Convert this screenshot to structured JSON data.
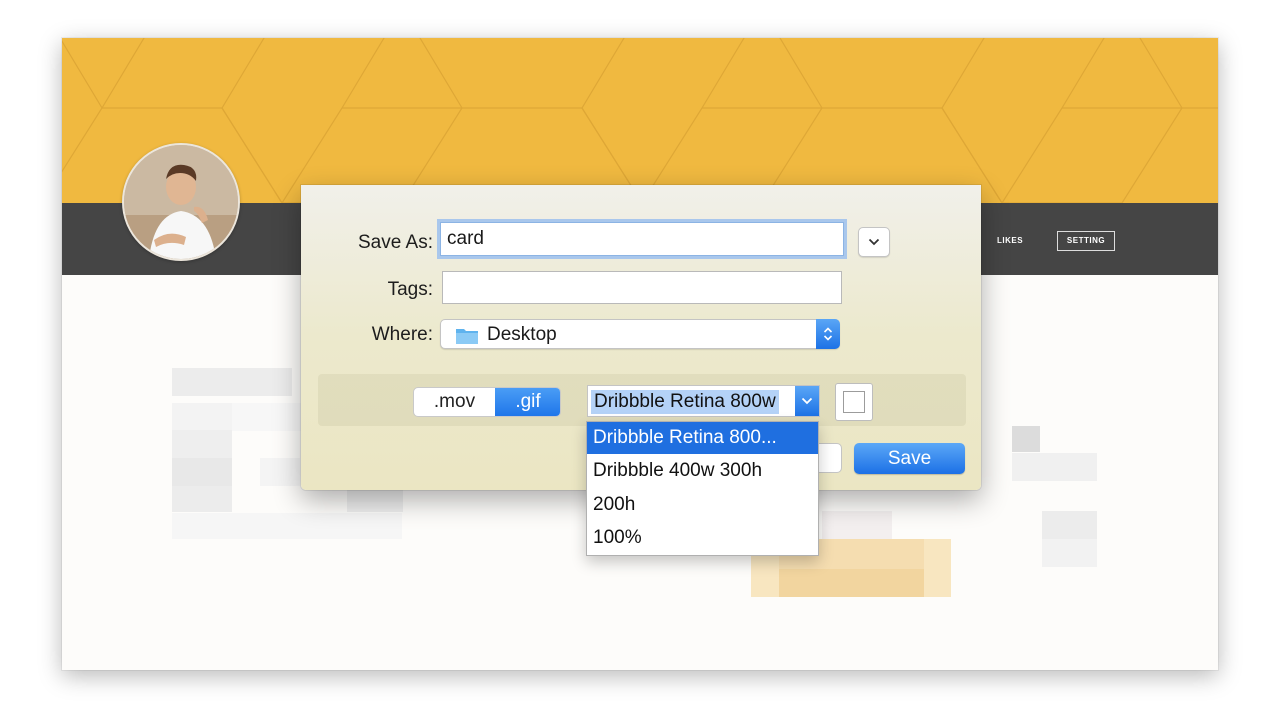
{
  "profile_page": {
    "nav": {
      "likes_label": "LIKES",
      "setting_label": "SETTING"
    },
    "colors": {
      "banner": "#f0b940",
      "navbar": "#454545"
    }
  },
  "save_dialog": {
    "save_as": {
      "label": "Save As:",
      "value": "card"
    },
    "tags": {
      "label": "Tags:",
      "value": ""
    },
    "where": {
      "label": "Where:",
      "value": "Desktop",
      "icon": "folder-icon"
    },
    "format": {
      "options": [
        ".mov",
        ".gif"
      ],
      "selected": ".gif"
    },
    "preset": {
      "selected": "Dribbble Retina 800w",
      "menu_items": [
        "Dribbble Retina 800...",
        "Dribbble 400w 300h",
        "200h",
        "100%"
      ],
      "highlighted_index": 0
    },
    "checkbox_checked": false,
    "save_button": "Save",
    "accent_color": "#1f76ea"
  }
}
